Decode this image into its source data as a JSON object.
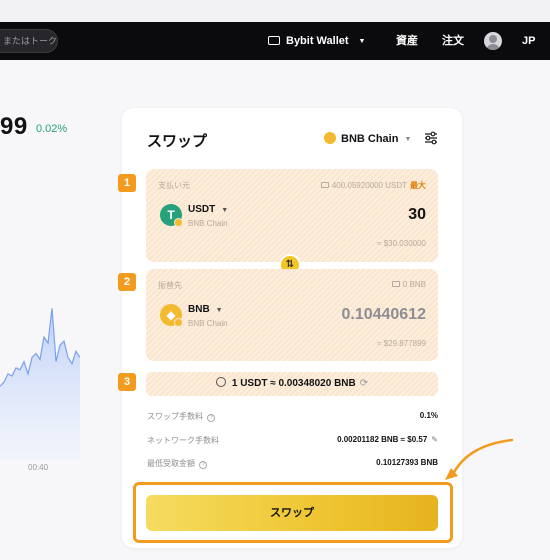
{
  "nav": {
    "search_placeholder": "またはトークンを",
    "wallet_label": "Bybit Wallet",
    "assets_label": "資産",
    "orders_label": "注文",
    "lang_label": "JP"
  },
  "market": {
    "price_fragment": "99",
    "change": "0.02%",
    "time_tick": "00:40",
    "chart_data": {
      "type": "area",
      "x": [
        0,
        1,
        2,
        3,
        4,
        5,
        6,
        7,
        8,
        9,
        10,
        11,
        12,
        13,
        14,
        15,
        16,
        17,
        18,
        19,
        20
      ],
      "values": [
        0.36,
        0.38,
        0.42,
        0.41,
        0.45,
        0.44,
        0.48,
        0.42,
        0.5,
        0.52,
        0.49,
        0.6,
        0.57,
        0.74,
        0.48,
        0.56,
        0.58,
        0.5,
        0.47,
        0.53,
        0.5
      ],
      "xlabel": "",
      "ylabel": "",
      "color": "#7aa0ee"
    }
  },
  "swap": {
    "title": "スワップ",
    "chain_label": "BNB Chain",
    "from": {
      "label": "支払い元",
      "balance": "400.05920000 USDT",
      "max_label": "最大",
      "token": "USDT",
      "chain": "BNB Chain",
      "amount": "30",
      "usd": "≈ $30.030000"
    },
    "to": {
      "label": "振替先",
      "balance": "0 BNB",
      "token": "BNB",
      "chain": "BNB Chain",
      "amount": "0.10440612",
      "usd": "≈ $29.877899"
    },
    "rate": "1 USDT ≈ 0.00348020 BNB",
    "fees": [
      {
        "label": "スワップ手数料",
        "value": "0.1%"
      },
      {
        "label": "ネットワーク手数料",
        "value": "0.00201182 BNB ≈ $0.57"
      },
      {
        "label": "最低受取金額",
        "value": "0.10127393 BNB"
      }
    ],
    "button_label": "スワップ"
  },
  "annotations": {
    "steps": [
      "1",
      "2",
      "3"
    ],
    "highlight_color": "#f29b1f"
  }
}
